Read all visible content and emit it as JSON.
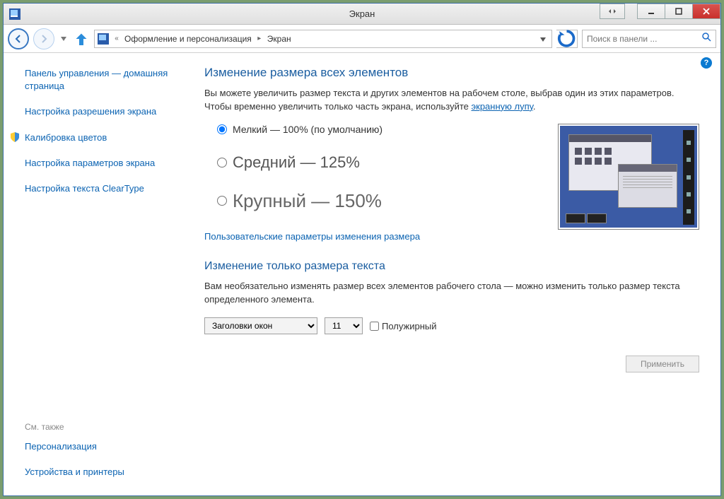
{
  "title": "Экран",
  "breadcrumb": {
    "level1": "Оформление и персонализация",
    "level2": "Экран"
  },
  "search": {
    "placeholder": "Поиск в панели ..."
  },
  "sidebar": {
    "home": "Панель управления — домашняя страница",
    "links": [
      "Настройка разрешения экрана",
      "Калибровка цветов",
      "Настройка параметров экрана",
      "Настройка текста ClearType"
    ],
    "see_also_heading": "См. также",
    "see_also": [
      "Персонализация",
      "Устройства и принтеры"
    ]
  },
  "main": {
    "heading1": "Изменение размера всех элементов",
    "para1_a": "Вы можете увеличить размер текста и других элементов на рабочем столе, выбрав один из этих параметров. Чтобы временно увеличить только часть экрана, используйте ",
    "para1_link": "экранную лупу",
    "para1_b": ".",
    "radios": [
      "Мелкий — 100% (по умолчанию)",
      "Средний — 125%",
      "Крупный — 150%"
    ],
    "custom_link": "Пользовательские параметры изменения размера",
    "heading2": "Изменение только размера текста",
    "para2": "Вам необязательно изменять размер всех элементов рабочего стола — можно изменить только размер текста определенного элемента.",
    "select_element": "Заголовки окон",
    "select_size": "11",
    "bold_label": "Полужирный",
    "apply": "Применить"
  }
}
